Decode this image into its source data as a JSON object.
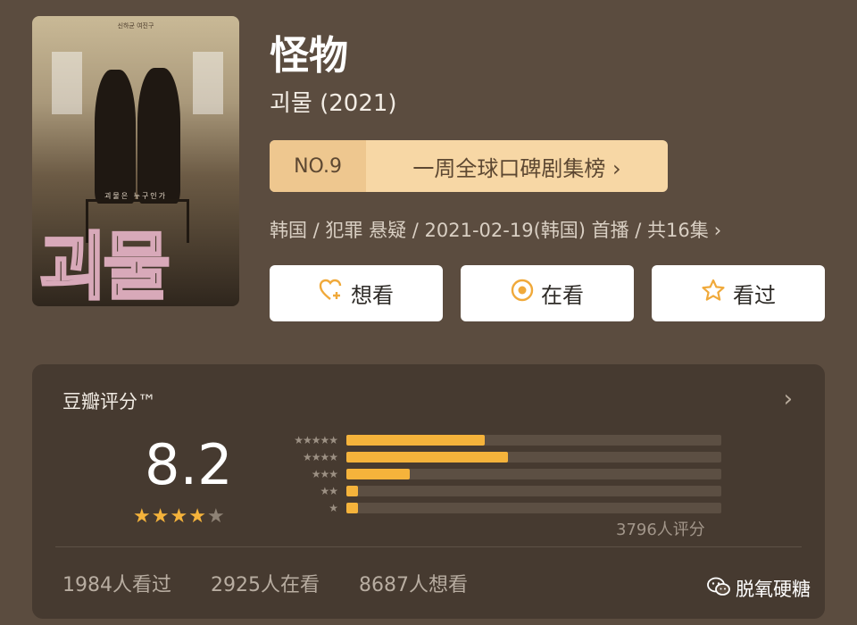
{
  "poster": {
    "top_text": "신하균 여진구",
    "mid_text": "괴물은 누구인가",
    "logo_text": "괴물"
  },
  "show": {
    "title": "怪物",
    "subtitle": "괴물 (2021)",
    "rank_no": "NO.9",
    "rank_label": "一周全球口碑剧集榜 ›",
    "meta": "韩国 / 犯罪 悬疑 / 2021-02-19(韩国) 首播 / 共16集",
    "meta_chevron": "›"
  },
  "actions": {
    "want": "想看",
    "watching": "在看",
    "watched": "看过"
  },
  "rating": {
    "title": "豆瓣评分™",
    "chevron": "›",
    "score": "8.2",
    "stars_filled": 4,
    "stars_total": 5,
    "distribution": [
      {
        "stars": 5,
        "fraction": 0.37
      },
      {
        "stars": 4,
        "fraction": 0.43
      },
      {
        "stars": 3,
        "fraction": 0.17
      },
      {
        "stars": 2,
        "fraction": 0.03
      },
      {
        "stars": 1,
        "fraction": 0.03
      }
    ],
    "count_text": "3796人评分",
    "watched_text": "1984人看过",
    "watching_text": "2925人在看",
    "want_text": "8687人想看"
  },
  "watermark": {
    "text": "脱氧硬糖"
  },
  "colors": {
    "accent": "#f5b33b",
    "background": "#5b4c3f",
    "card": "#463a30"
  }
}
